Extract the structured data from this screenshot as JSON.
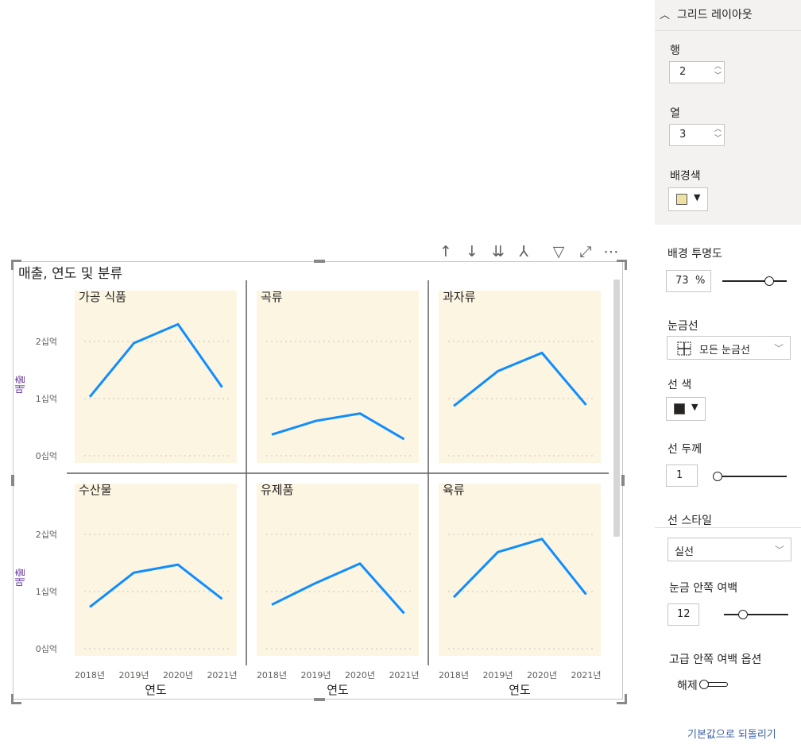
{
  "visual": {
    "title": "매출, 연도 및 분류",
    "toolbar": [
      {
        "name": "drill-up-icon",
        "glyph": "↑"
      },
      {
        "name": "drill-down-icon",
        "glyph": "↓"
      },
      {
        "name": "expand-next-level-icon",
        "glyph": "⇊"
      },
      {
        "name": "expand-hierarchy-icon",
        "glyph": "⅄"
      },
      {
        "name": "filter-icon",
        "glyph": "▽"
      },
      {
        "name": "focus-mode-icon",
        "glyph": "⤢"
      },
      {
        "name": "more-options-icon",
        "glyph": "⋯"
      }
    ]
  },
  "chart_data": {
    "type": "line",
    "layout": "small-multiples",
    "x": [
      "2018년",
      "2019년",
      "2020년",
      "2021년"
    ],
    "xlabel": "연도",
    "ylabel": "매출",
    "yticks": [
      "0십억",
      "1십억",
      "2십억"
    ],
    "ylim": [
      0,
      3
    ],
    "line_color": "#118dff",
    "panel_background": "#fbf5e1",
    "gridlines": "dotted",
    "series": [
      {
        "name": "가공 식품",
        "values": [
          1.03,
          1.97,
          2.3,
          1.2
        ]
      },
      {
        "name": "곡류",
        "values": [
          0.37,
          0.61,
          0.74,
          0.29
        ]
      },
      {
        "name": "과자류",
        "values": [
          0.87,
          1.48,
          1.8,
          0.89
        ]
      },
      {
        "name": "수산물",
        "values": [
          0.73,
          1.33,
          1.47,
          0.87
        ]
      },
      {
        "name": "유제품",
        "values": [
          0.77,
          1.15,
          1.49,
          0.62
        ]
      },
      {
        "name": "육류",
        "values": [
          0.9,
          1.69,
          1.92,
          0.95
        ]
      }
    ]
  },
  "pane": {
    "section_title": "그리드 레이아웃",
    "rows_label": "행",
    "rows_value": "2",
    "cols_label": "열",
    "cols_value": "3",
    "bg_color_label": "배경색",
    "bg_color": "#efe0a3",
    "bg_transparency_label": "배경 투명도",
    "bg_transparency_value": "73",
    "percent_sign": "%",
    "bg_transparency_level": 0.73,
    "gridlines_label": "눈금선",
    "gridlines_value": "모든 눈금선",
    "line_color_label": "선 색",
    "line_color": "#252423",
    "line_width_label": "선 두께",
    "line_width_value": "1",
    "line_width_level": 0.0,
    "line_style_label": "선 스타일",
    "line_style_value": "실선",
    "inner_padding_label": "눈금 안쪽 여백",
    "inner_padding_value": "12",
    "inner_padding_level": 0.3,
    "advanced_padding_label": "고급 안쪽 여백 옵션",
    "toggle_label": "해제",
    "reset_link": "기본값으로 되돌리기"
  }
}
